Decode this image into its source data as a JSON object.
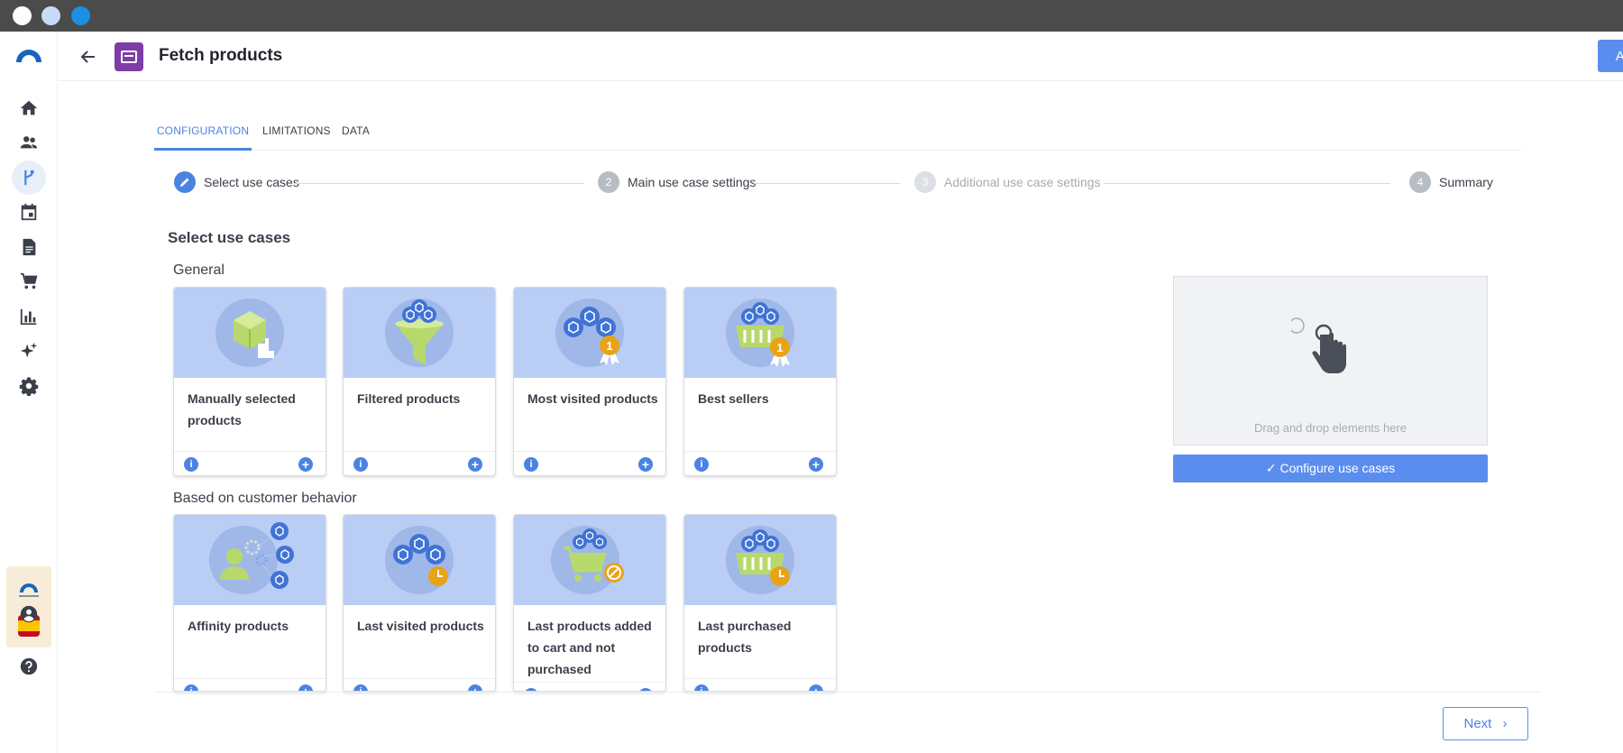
{
  "header": {
    "title": "Fetch products",
    "apply_label": "Apply"
  },
  "tabs": [
    {
      "label": "CONFIGURATION",
      "active": true
    },
    {
      "label": "LIMITATIONS",
      "active": false
    },
    {
      "label": "DATA",
      "active": false
    }
  ],
  "stepper": [
    {
      "number": "",
      "label": "Select use cases",
      "state": "active"
    },
    {
      "number": "2",
      "label": "Main use case settings",
      "state": "pending"
    },
    {
      "number": "3",
      "label": "Additional use case settings",
      "state": "disabled"
    },
    {
      "number": "4",
      "label": "Summary",
      "state": "pending"
    }
  ],
  "section": {
    "title": "Select use cases"
  },
  "groups": [
    {
      "label": "General",
      "cards": [
        {
          "title": "Manually selected products",
          "icon": "box-hand-icon"
        },
        {
          "title": "Filtered products",
          "icon": "funnel-boxes-icon"
        },
        {
          "title": "Most visited products",
          "icon": "boxes-medal-icon"
        },
        {
          "title": "Best sellers",
          "icon": "basket-medal-icon"
        }
      ]
    },
    {
      "label": "Based on customer behavior",
      "cards": [
        {
          "title": "Affinity products",
          "icon": "person-gears-icon"
        },
        {
          "title": "Last visited products",
          "icon": "boxes-clock-icon"
        },
        {
          "title": "Last products added to cart and not purchased",
          "icon": "cart-blocked-icon"
        },
        {
          "title": "Last purchased products",
          "icon": "basket-clock-icon"
        }
      ]
    }
  ],
  "card_buttons": {
    "info": "i",
    "add": "+"
  },
  "dropzone": {
    "text": "Drag and drop elements here",
    "configure_label": "Configure use cases"
  },
  "footer": {
    "next_label": "Next"
  },
  "sidebar": {
    "items": [
      "home-icon",
      "people-icon",
      "flow-icon",
      "calendar-icon",
      "document-icon",
      "cart-icon",
      "chart-icon",
      "sparkle-icon",
      "gear-icon"
    ],
    "active": "flow-icon"
  },
  "colors": {
    "accent": "#5b8def",
    "card_bg": "#b9cdf5",
    "medal": "#e8a317"
  }
}
